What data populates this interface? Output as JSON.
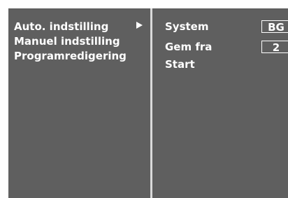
{
  "menu": {
    "items": [
      {
        "label": "Auto. indstilling",
        "selected": true,
        "has_submenu": true
      },
      {
        "label": "Manuel indstilling"
      },
      {
        "label": "Programredigering"
      }
    ],
    "arrow_icon": "triangle-right-icon"
  },
  "submenu": {
    "system_label": "System",
    "system_value": "BG",
    "gem_fra_label": "Gem fra",
    "gem_fra_value": "2",
    "start_label": "Start"
  },
  "colors": {
    "background": "#5f5f5f",
    "text": "#ffffff",
    "divider": "#d9d9d9"
  }
}
